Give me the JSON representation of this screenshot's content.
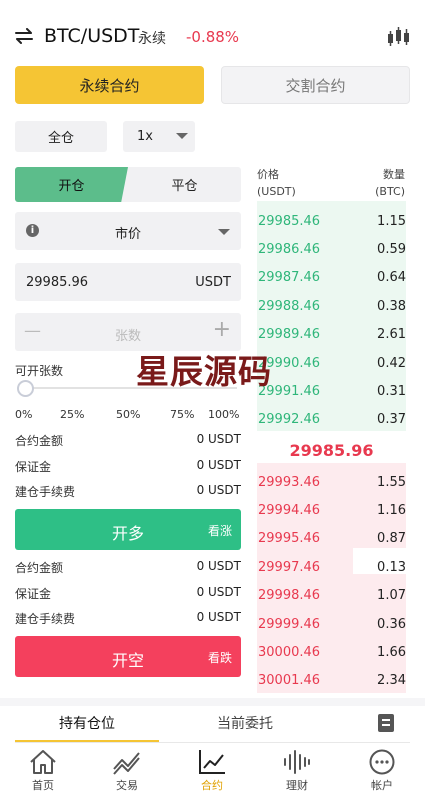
{
  "header": {
    "pair": "BTC/USDT",
    "contract_type": "永续",
    "change": "-0.88%"
  },
  "contract_tabs": [
    "永续合约",
    "交割合约"
  ],
  "margin_mode": "全仓",
  "leverage": "1x",
  "open_close_tabs": [
    "开仓",
    "平仓"
  ],
  "order_type": "市价",
  "price_input": {
    "value": "29985.96",
    "unit": "USDT"
  },
  "qty_input": {
    "placeholder": "张数",
    "minus": "—",
    "plus": "+"
  },
  "available_label": "可开张数",
  "slider": {
    "value": 0,
    "marks": [
      "0%",
      "25%",
      "50%",
      "75%",
      "100%"
    ]
  },
  "long_info": [
    {
      "label": "合约金额",
      "value": "0 USDT"
    },
    {
      "label": "保证金",
      "value": "0 USDT"
    },
    {
      "label": "建仓手续费",
      "value": "0 USDT"
    }
  ],
  "long_button": {
    "label": "开多",
    "tag": "看涨"
  },
  "short_info": [
    {
      "label": "合约金额",
      "value": "0 USDT"
    },
    {
      "label": "保证金",
      "value": "0 USDT"
    },
    {
      "label": "建仓手续费",
      "value": "0 USDT"
    }
  ],
  "short_button": {
    "label": "开空",
    "tag": "看跌"
  },
  "orderbook": {
    "price_header": "价格",
    "price_unit": "(USDT)",
    "qty_header": "数量",
    "qty_unit": "(BTC)",
    "bids": [
      {
        "price": "29985.46",
        "qty": "1.15"
      },
      {
        "price": "29986.46",
        "qty": "0.59"
      },
      {
        "price": "29987.46",
        "qty": "0.64"
      },
      {
        "price": "29988.46",
        "qty": "0.38"
      },
      {
        "price": "29989.46",
        "qty": "2.61"
      },
      {
        "price": "29990.46",
        "qty": "0.42"
      },
      {
        "price": "29991.46",
        "qty": "0.31"
      },
      {
        "price": "29992.46",
        "qty": "0.37"
      }
    ],
    "last_price": "29985.96",
    "asks": [
      {
        "price": "29993.46",
        "qty": "1.55"
      },
      {
        "price": "29994.46",
        "qty": "1.16"
      },
      {
        "price": "29995.46",
        "qty": "0.87"
      },
      {
        "price": "29997.46",
        "qty": "0.13"
      },
      {
        "price": "29998.46",
        "qty": "1.07"
      },
      {
        "price": "29999.46",
        "qty": "0.36"
      },
      {
        "price": "30000.46",
        "qty": "1.66"
      },
      {
        "price": "30001.46",
        "qty": "2.34"
      }
    ]
  },
  "watermark": "星辰源码",
  "bottom_tabs": [
    "持有仓位",
    "当前委托"
  ],
  "nav": [
    {
      "label": "首页",
      "icon": "home-icon"
    },
    {
      "label": "交易",
      "icon": "trend-icon"
    },
    {
      "label": "合约",
      "icon": "chart-icon",
      "active": true
    },
    {
      "label": "理财",
      "icon": "wave-icon"
    },
    {
      "label": "帐户",
      "icon": "account-icon"
    }
  ],
  "colors": {
    "accent": "#f5c534",
    "green": "#2fb67a",
    "red": "#e8394f",
    "long_button": "#2ebf86",
    "short_button": "#f4405d"
  }
}
